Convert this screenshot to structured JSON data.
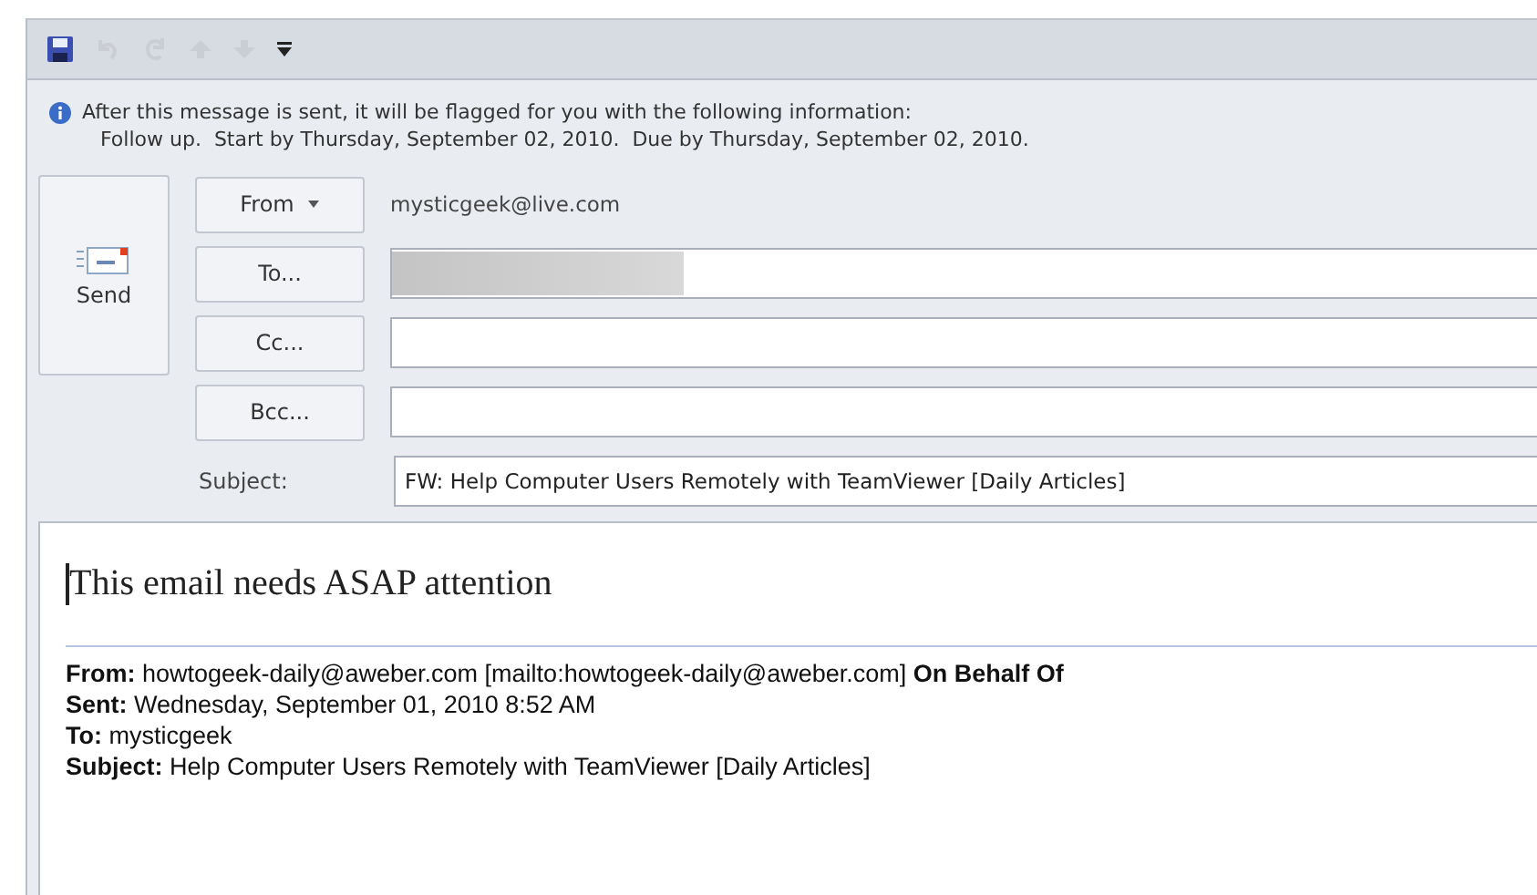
{
  "toolbar": [
    {
      "kind": "save",
      "disabled": false
    },
    {
      "kind": "undo",
      "disabled": true
    },
    {
      "kind": "redo",
      "disabled": true
    },
    {
      "kind": "up",
      "disabled": true
    },
    {
      "kind": "down",
      "disabled": true
    },
    {
      "kind": "customize",
      "disabled": false
    }
  ],
  "info": {
    "lines": [
      "After this message is sent, it will be flagged for you with the following information:",
      "Follow up.  Start by Thursday, September 02, 2010.  Due by Thursday, September 02, 2010."
    ]
  },
  "send": {
    "label": "Send"
  },
  "fields": [
    {
      "kind": "account",
      "label": "From",
      "dropdown": true,
      "value": "mysticgeek@live.com"
    },
    {
      "kind": "recipients",
      "label": "To...",
      "blurred": true
    },
    {
      "kind": "recipients",
      "label": "Cc...",
      "blurred": false
    },
    {
      "kind": "recipients",
      "label": "Bcc...",
      "blurred": false
    },
    {
      "kind": "subject",
      "label": "Subject:",
      "value": "FW: Help Computer Users Remotely with TeamViewer [Daily Articles]"
    }
  ],
  "body": {
    "text": "This email needs ASAP attention",
    "forwarded": [
      "**From:** howtogeek-daily@aweber.com [mailto:howtogeek-daily@aweber.com] **On Behalf Of**",
      "**Sent:** Wednesday, September 01, 2010 8:52 AM",
      "**To:** mysticgeek",
      "**Subject:** Help Computer Users Remotely with TeamViewer [Daily Articles]"
    ]
  }
}
